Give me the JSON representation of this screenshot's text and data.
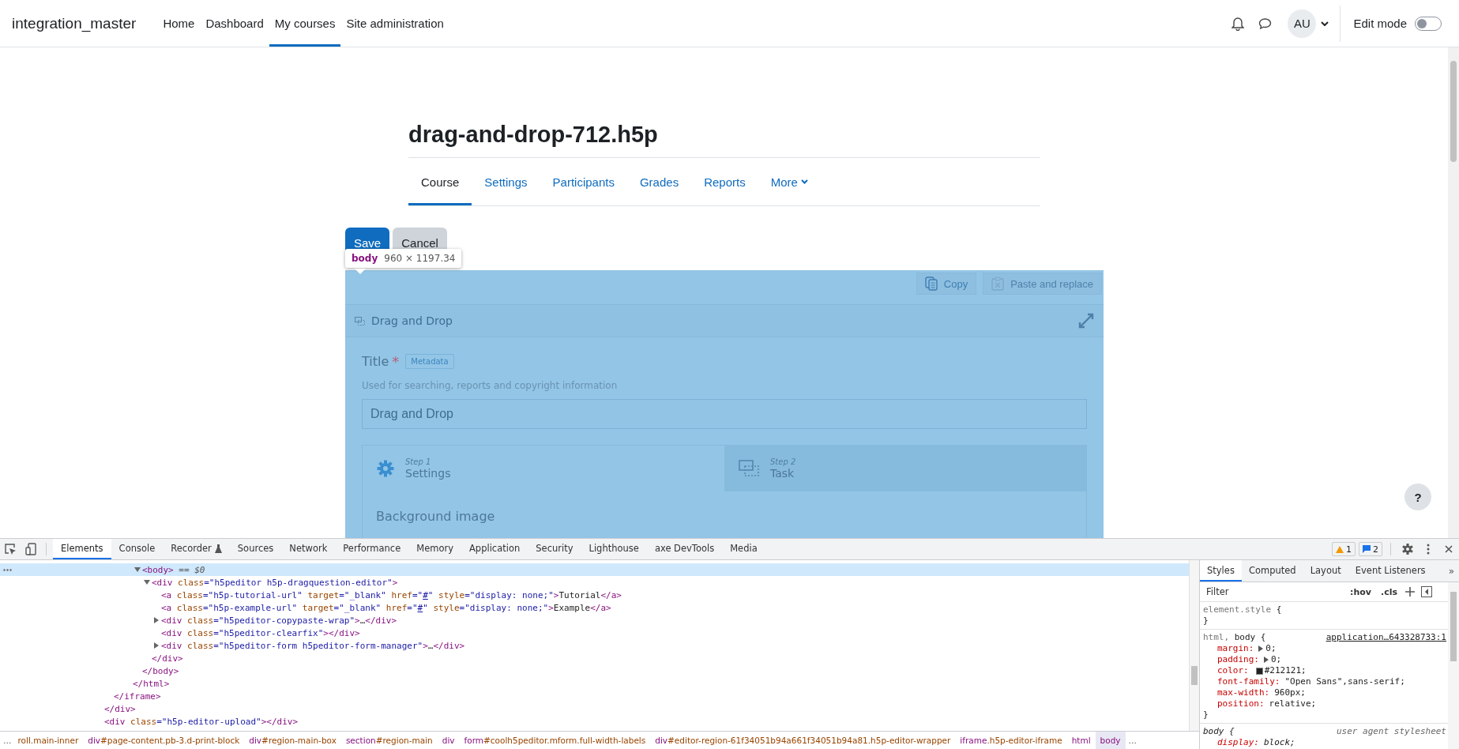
{
  "navbar": {
    "brand": "integration_master",
    "links": [
      {
        "label": "Home",
        "selected": false
      },
      {
        "label": "Dashboard",
        "selected": false
      },
      {
        "label": "My courses",
        "selected": true
      },
      {
        "label": "Site administration",
        "selected": false
      }
    ],
    "avatar": "AU",
    "edit_mode": {
      "label": "Edit mode",
      "on": false
    }
  },
  "course": {
    "title": "drag-and-drop-712.h5p",
    "tabs": [
      {
        "label": "Course",
        "selected": true
      },
      {
        "label": "Settings",
        "selected": false
      },
      {
        "label": "Participants",
        "selected": false
      },
      {
        "label": "Grades",
        "selected": false
      },
      {
        "label": "Reports",
        "selected": false
      },
      {
        "label": "More",
        "selected": false,
        "kind": "menu"
      }
    ]
  },
  "form_buttons": [
    {
      "label": "Save",
      "kind": "primary"
    },
    {
      "label": "Cancel",
      "kind": "secondary"
    }
  ],
  "inspect_tooltip": {
    "element": "body",
    "size": "960 × 1197.34"
  },
  "editor": {
    "clipboard_buttons": [
      {
        "label": "Copy",
        "kind": "copy",
        "disabled": false
      },
      {
        "label": "Paste and replace",
        "kind": "paste",
        "disabled": true
      }
    ],
    "content_type": "Drag and Drop",
    "title_field": {
      "label": "Title",
      "required_mark": "*",
      "metadata": "Metadata",
      "description": "Used for searching, reports and copyright information",
      "value": "Drag and Drop"
    },
    "steps": [
      {
        "step": "Step 1",
        "label": "Settings",
        "kind": "settings",
        "selected": true
      },
      {
        "step": "Step 2",
        "label": "Task",
        "kind": "task",
        "selected": false
      }
    ],
    "section_heading": "Background image"
  },
  "help_button": "?",
  "devtools": {
    "tabs": [
      {
        "label": "Elements",
        "selected": true
      },
      {
        "label": "Console",
        "selected": false
      },
      {
        "label": "Recorder",
        "selected": false,
        "kind": "experimental"
      },
      {
        "label": "Sources",
        "selected": false
      },
      {
        "label": "Network",
        "selected": false
      },
      {
        "label": "Performance",
        "selected": false
      },
      {
        "label": "Memory",
        "selected": false
      },
      {
        "label": "Application",
        "selected": false
      },
      {
        "label": "Security",
        "selected": false
      },
      {
        "label": "Lighthouse",
        "selected": false
      },
      {
        "label": "axe DevTools",
        "selected": false
      },
      {
        "label": "Media",
        "selected": false
      }
    ],
    "warnings": "1",
    "messages": "2",
    "elements": {
      "tree": [
        {
          "children": [
            {
              "children": [
                {
                  "children": [
                    {
                      "children": [
                        {
                          "expanded": true,
                          "selected": true,
                          "open": [
                            {
                              "kind": "tag",
                              "text": "<body>"
                            },
                            {
                              "kind": "note",
                              "text": " == $0"
                            }
                          ],
                          "children": [
                            {
                              "expanded": true,
                              "selected": false,
                              "open": [
                                {
                                  "kind": "tag",
                                  "text": "<div"
                                },
                                {
                                  "kind": "attr",
                                  "text": " class"
                                },
                                {
                                  "kind": "value",
                                  "text": "=\"h5peditor h5p-dragquestion-editor\""
                                },
                                {
                                  "kind": "tag",
                                  "text": ">"
                                }
                              ],
                              "children": [
                                {
                                  "selected": false,
                                  "open": [
                                    {
                                      "kind": "tag",
                                      "text": "<a"
                                    },
                                    {
                                      "kind": "attr",
                                      "text": " class"
                                    },
                                    {
                                      "kind": "value",
                                      "text": "=\"h5p-tutorial-url\""
                                    },
                                    {
                                      "kind": "attr",
                                      "text": " target"
                                    },
                                    {
                                      "kind": "value",
                                      "text": "=\"_blank\""
                                    },
                                    {
                                      "kind": "attr",
                                      "text": " href"
                                    },
                                    {
                                      "kind": "value",
                                      "text": "=\""
                                    },
                                    {
                                      "kind": "link",
                                      "text": "#"
                                    },
                                    {
                                      "kind": "value",
                                      "text": "\""
                                    },
                                    {
                                      "kind": "attr",
                                      "text": " style"
                                    },
                                    {
                                      "kind": "value",
                                      "text": "=\"display: none;\""
                                    },
                                    {
                                      "kind": "tag",
                                      "text": ">"
                                    },
                                    {
                                      "kind": "text",
                                      "text": "Tutorial"
                                    },
                                    {
                                      "kind": "tag",
                                      "text": "</a>"
                                    }
                                  ]
                                },
                                {
                                  "selected": false,
                                  "open": [
                                    {
                                      "kind": "tag",
                                      "text": "<a"
                                    },
                                    {
                                      "kind": "attr",
                                      "text": " class"
                                    },
                                    {
                                      "kind": "value",
                                      "text": "=\"h5p-example-url\""
                                    },
                                    {
                                      "kind": "attr",
                                      "text": " target"
                                    },
                                    {
                                      "kind": "value",
                                      "text": "=\"_blank\""
                                    },
                                    {
                                      "kind": "attr",
                                      "text": " href"
                                    },
                                    {
                                      "kind": "value",
                                      "text": "=\""
                                    },
                                    {
                                      "kind": "link",
                                      "text": "#"
                                    },
                                    {
                                      "kind": "value",
                                      "text": "\""
                                    },
                                    {
                                      "kind": "attr",
                                      "text": " style"
                                    },
                                    {
                                      "kind": "value",
                                      "text": "=\"display: none;\""
                                    },
                                    {
                                      "kind": "tag",
                                      "text": ">"
                                    },
                                    {
                                      "kind": "text",
                                      "text": "Example"
                                    },
                                    {
                                      "kind": "tag",
                                      "text": "</a>"
                                    }
                                  ]
                                },
                                {
                                  "expanded": false,
                                  "selected": false,
                                  "open": [
                                    {
                                      "kind": "tag",
                                      "text": "<div"
                                    },
                                    {
                                      "kind": "attr",
                                      "text": " class"
                                    },
                                    {
                                      "kind": "value",
                                      "text": "=\"h5peditor-copypaste-wrap\""
                                    },
                                    {
                                      "kind": "tag",
                                      "text": ">"
                                    },
                                    {
                                      "kind": "text",
                                      "text": "…"
                                    },
                                    {
                                      "kind": "tag",
                                      "text": "</div>"
                                    }
                                  ]
                                },
                                {
                                  "selected": false,
                                  "open": [
                                    {
                                      "kind": "tag",
                                      "text": "<div"
                                    },
                                    {
                                      "kind": "attr",
                                      "text": " class"
                                    },
                                    {
                                      "kind": "value",
                                      "text": "=\"h5peditor-clearfix\""
                                    },
                                    {
                                      "kind": "tag",
                                      "text": "></div>"
                                    }
                                  ]
                                },
                                {
                                  "expanded": false,
                                  "selected": false,
                                  "open": [
                                    {
                                      "kind": "tag",
                                      "text": "<div"
                                    },
                                    {
                                      "kind": "attr",
                                      "text": " class"
                                    },
                                    {
                                      "kind": "value",
                                      "text": "=\"h5peditor-form h5peditor-form-manager\""
                                    },
                                    {
                                      "kind": "tag",
                                      "text": ">"
                                    },
                                    {
                                      "kind": "text",
                                      "text": "…"
                                    },
                                    {
                                      "kind": "tag",
                                      "text": "</div>"
                                    }
                                  ]
                                }
                              ],
                              "close": [
                                {
                                  "kind": "tag",
                                  "text": "</div>"
                                }
                              ]
                            }
                          ],
                          "close": [
                            {
                              "kind": "tag",
                              "text": "</body>"
                            }
                          ]
                        }
                      ],
                      "close": [
                        {
                          "kind": "tag",
                          "text": "</html>"
                        }
                      ]
                    }
                  ]
                }
              ],
              "close": [
                {
                  "kind": "tag",
                  "text": "</iframe>"
                }
              ]
            }
          ],
          "close": [
            {
              "kind": "tag",
              "text": "</div>"
            }
          ]
        },
        {
          "selected": false,
          "open": [
            {
              "kind": "tag",
              "text": "<div"
            },
            {
              "kind": "attr",
              "text": " class"
            },
            {
              "kind": "value",
              "text": "=\"h5p-editor-upload\""
            },
            {
              "kind": "tag",
              "text": "></div>"
            }
          ]
        }
      ]
    },
    "styles": {
      "tabs": [
        {
          "label": "Styles",
          "selected": true
        },
        {
          "label": "Computed",
          "selected": false
        },
        {
          "label": "Layout",
          "selected": false
        },
        {
          "label": "Event Listeners",
          "selected": false
        }
      ],
      "overflow": "»",
      "filter_placeholder": "Filter",
      "hov": ":hov",
      "cls": ".cls",
      "rules": [
        {
          "kind": "inline",
          "selector": [
            {
              "text": "element.style",
              "matched": false
            },
            {
              "text": " {",
              "matched": true
            }
          ],
          "close": "}"
        },
        {
          "kind": "author",
          "selector": [
            {
              "text": "html, ",
              "matched": false
            },
            {
              "text": "body {",
              "matched": true
            }
          ],
          "source": "application…643328733:1",
          "properties": [
            {
              "name": "margin:",
              "value": "0;",
              "expandable": true
            },
            {
              "name": "padding:",
              "value": "0;",
              "expandable": true
            },
            {
              "name": "color:",
              "value": "#212121;",
              "color": "#212121"
            },
            {
              "name": "font-family:",
              "value": "\"Open Sans\",sans-serif;"
            },
            {
              "name": "max-width:",
              "value": "960px;"
            },
            {
              "name": "position:",
              "value": "relative;"
            }
          ],
          "close": "}"
        },
        {
          "kind": "user-agent",
          "selector": [
            {
              "text": "body {",
              "matched": true
            }
          ],
          "source": "user agent stylesheet",
          "properties": [
            {
              "name": "display:",
              "value": "block;"
            }
          ]
        }
      ]
    },
    "breadcrumbs": {
      "lead": "…",
      "items": [
        {
          "rest": "roll.main-inner",
          "selected": false
        },
        {
          "tag": "div",
          "rest": "#page-content.pb-3.d-print-block",
          "selected": false
        },
        {
          "tag": "div",
          "rest": "#region-main-box",
          "selected": false
        },
        {
          "tag": "section",
          "rest": "#region-main",
          "selected": false
        },
        {
          "tag": "div",
          "selected": false
        },
        {
          "tag": "form",
          "rest": "#coolh5peditor.mform.full-width-labels",
          "selected": false
        },
        {
          "tag": "div",
          "rest": "#editor-region-61f34051b94a661f34051b94a81.h5p-editor-wrapper",
          "selected": false
        },
        {
          "tag": "iframe",
          "rest": ".h5p-editor-iframe",
          "selected": false
        },
        {
          "tag": "html",
          "selected": false
        },
        {
          "tag": "body",
          "selected": true
        }
      ],
      "trail": "…"
    }
  }
}
